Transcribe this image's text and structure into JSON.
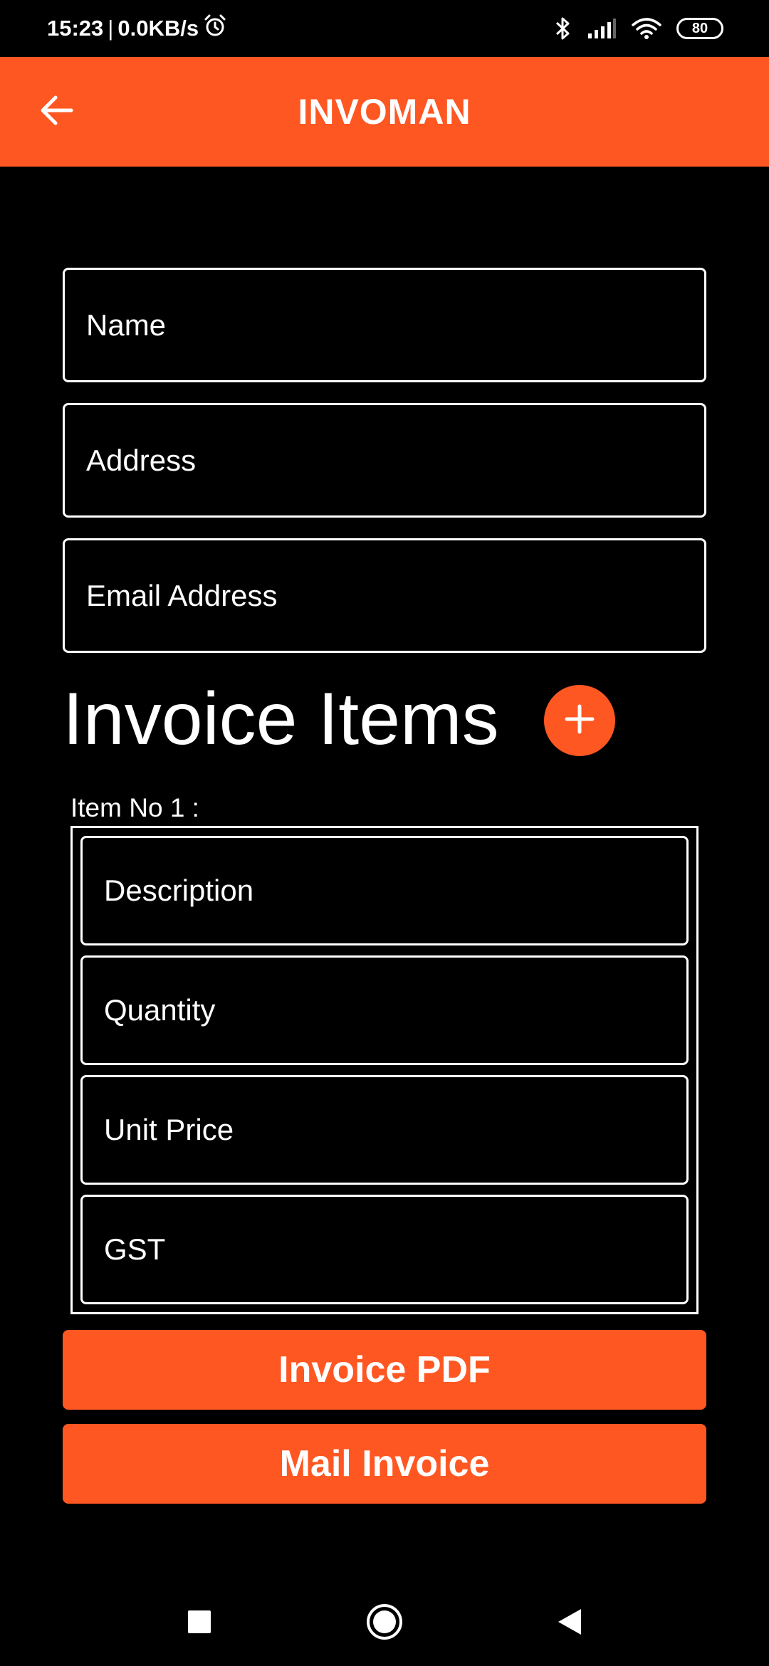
{
  "status_bar": {
    "time": "15:23",
    "separator": "|",
    "network_speed": "0.0KB/s",
    "battery_level": "80",
    "icons": [
      "alarm-icon",
      "bluetooth-icon",
      "signal-icon",
      "wifi-icon",
      "battery-icon"
    ]
  },
  "app_bar": {
    "title": "INVOMAN",
    "back_icon": "arrow-left-icon"
  },
  "form": {
    "name_placeholder": "Name",
    "address_placeholder": "Address",
    "email_placeholder": "Email Address"
  },
  "invoice_items": {
    "title": "Invoice Items",
    "add_icon": "plus-icon",
    "items": [
      {
        "label": "Item No 1 :",
        "description_placeholder": "Description",
        "quantity_placeholder": "Quantity",
        "unit_price_placeholder": "Unit Price",
        "gst_placeholder": "GST"
      }
    ]
  },
  "actions": {
    "invoice_pdf_label": "Invoice PDF",
    "mail_invoice_label": "Mail Invoice"
  },
  "nav_bar": {
    "icons": [
      "recents-square-icon",
      "home-circle-icon",
      "back-triangle-icon"
    ]
  },
  "colors": {
    "accent": "#FF5722",
    "background": "#000000",
    "text": "#FFFFFF"
  }
}
